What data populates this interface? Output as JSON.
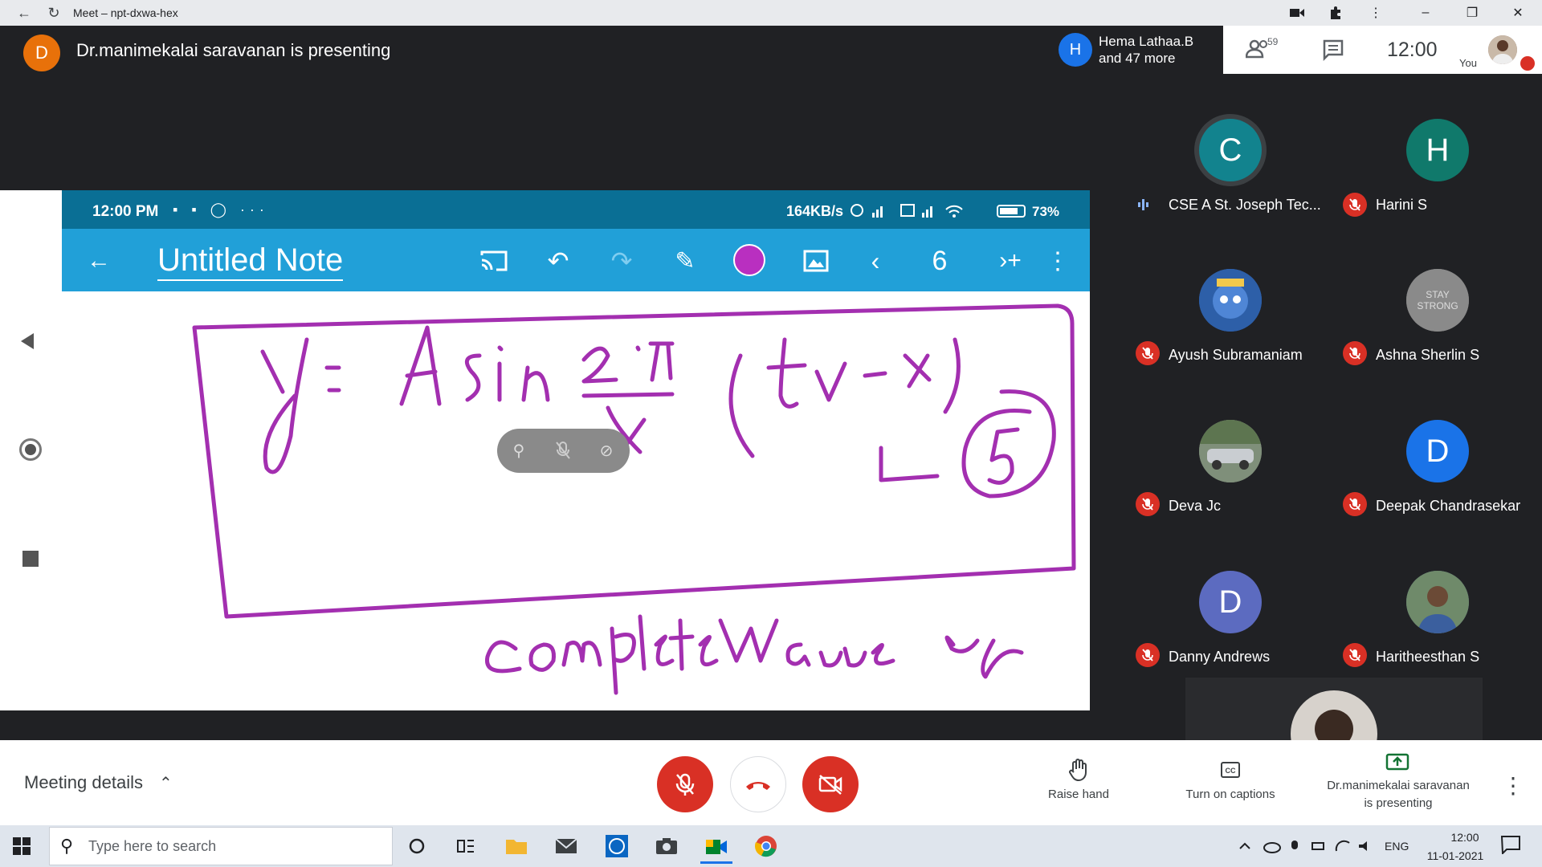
{
  "browser": {
    "title": "Meet – npt-dxwa-hex"
  },
  "presenting": {
    "avatar_letter": "D",
    "text": "Dr.manimekalai saravanan is presenting"
  },
  "header": {
    "participant_avatar_letter": "H",
    "participant_line1": "Hema Lathaa.B",
    "participant_line2": "and 47 more",
    "people_count": "59",
    "clock": "12:00",
    "you_label": "You"
  },
  "shared_screen": {
    "status_time": "12:00 PM",
    "status_left_icons": "▪ ▪ ◯ ···",
    "status_speed": "164KB/s",
    "status_battery": "73",
    "status_battery_unit": "%",
    "app_title": "Untitled Note",
    "page_number": "6",
    "pen_color": "#b92fc0"
  },
  "participants": [
    {
      "name": "CSE A St. Joseph Tec...",
      "letter": "C",
      "color": "#12838e",
      "state": "speaking"
    },
    {
      "name": "Harini S",
      "letter": "H",
      "color": "#10796b",
      "state": "muted"
    },
    {
      "name": "Ayush Subramaniam",
      "letter": "",
      "color": "#2a5db0",
      "state": "muted"
    },
    {
      "name": "Ashna Sherlin S",
      "letter": "",
      "color": "#6d6d6d",
      "state": "muted"
    },
    {
      "name": "Deva Jc",
      "letter": "",
      "color": "#6a7a6a",
      "state": "muted"
    },
    {
      "name": "Deepak Chandrasekar",
      "letter": "D",
      "color": "#1a73e8",
      "state": "muted"
    },
    {
      "name": "Danny Andrews",
      "letter": "D",
      "color": "#5c6bc0",
      "state": "muted"
    },
    {
      "name": "Haritheesthan S",
      "letter": "",
      "color": "#4a6a8a",
      "state": "muted"
    }
  ],
  "controls": {
    "meeting_details": "Meeting details",
    "raise_hand": "Raise hand",
    "captions": "Turn on captions",
    "presenting_line1": "Dr.manimekalai saravanan",
    "presenting_line2": "is presenting"
  },
  "taskbar": {
    "search_placeholder": "Type here to search",
    "language": "ENG",
    "time": "12:00",
    "date": "11-01-2021"
  }
}
